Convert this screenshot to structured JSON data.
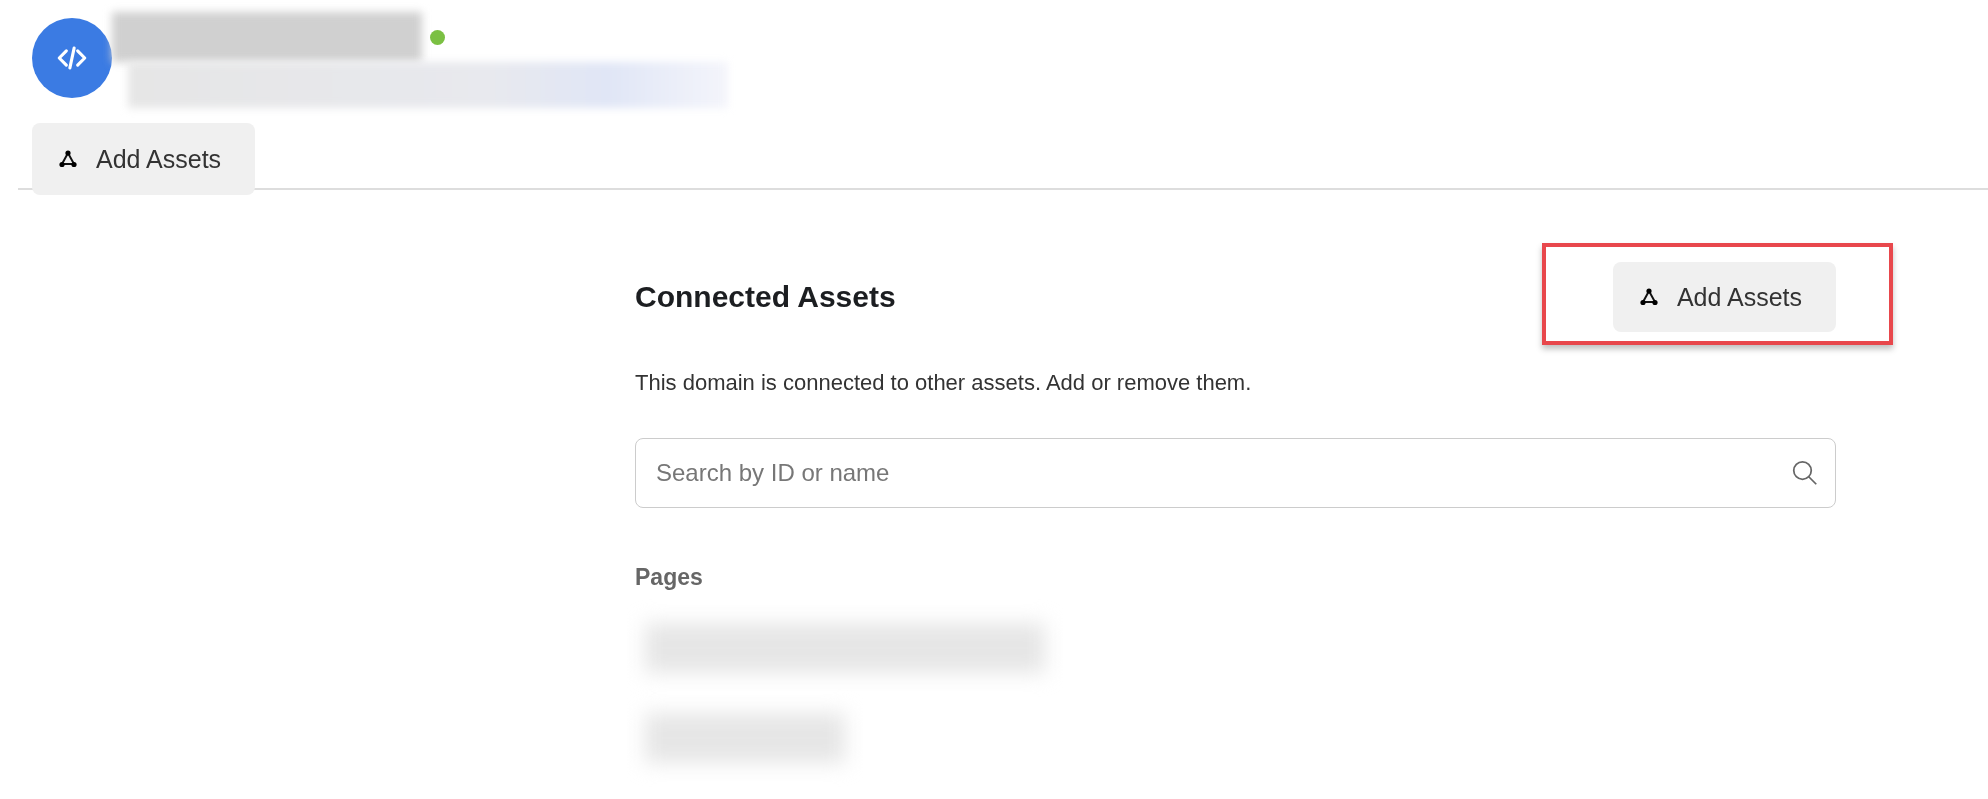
{
  "header": {
    "online": true
  },
  "toolbar": {
    "button": {
      "label": "Add Assets"
    }
  },
  "section": {
    "title": "Connected Assets",
    "button": {
      "label": "Add Assets",
      "highlighted": true
    },
    "description": "This domain is connected to other assets. Add or remove them.",
    "search": {
      "placeholder": "Search by ID or name"
    },
    "group_label": "Pages"
  }
}
